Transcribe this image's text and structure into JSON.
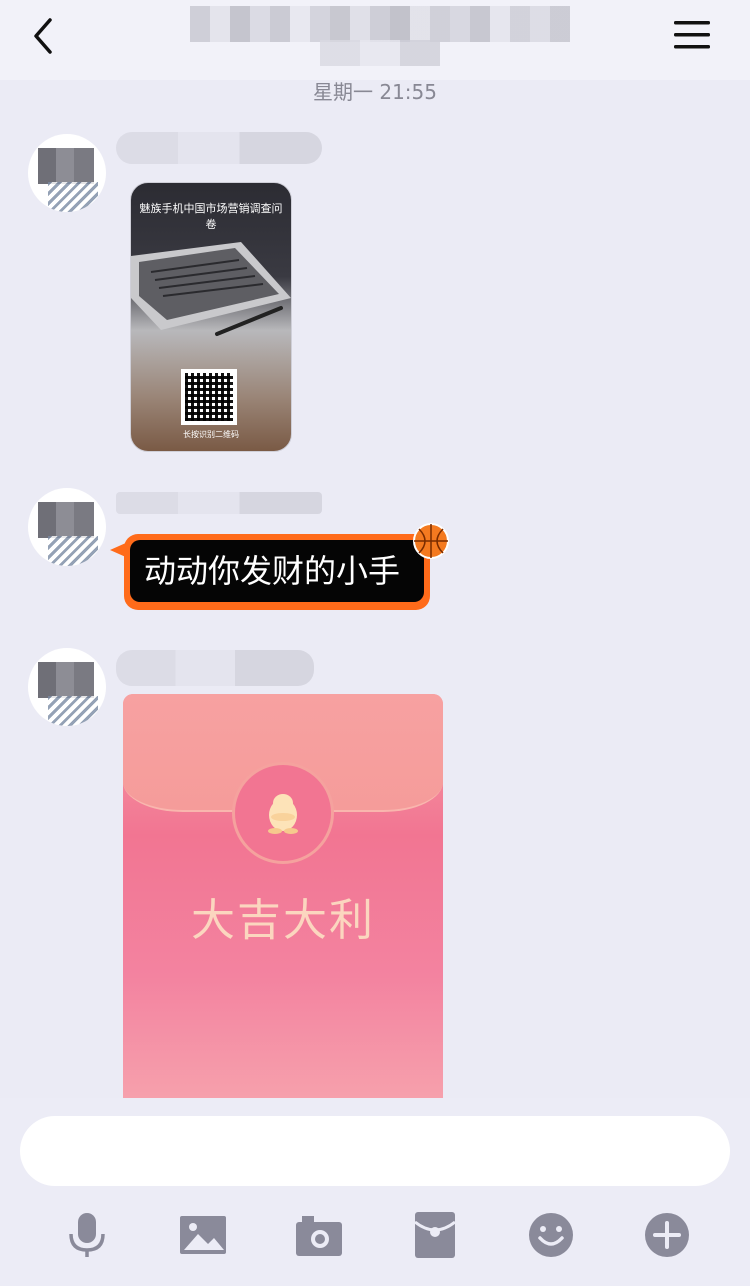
{
  "header": {
    "back_icon": "chevron-left-icon",
    "menu_icon": "hamburger-menu-icon"
  },
  "timestamp": "星期一 21:55",
  "messages": [
    {
      "type": "image-card",
      "card_title": "魅族手机中国市场营销调查问卷",
      "card_footer": "长按识别二维码"
    },
    {
      "type": "text",
      "text": "动动你发财的小手",
      "bubble_color": "#ff6b1a",
      "decoration_icon": "basketball-icon"
    },
    {
      "type": "red-envelope",
      "greeting": "大吉大利",
      "icon": "penguin-icon"
    }
  ],
  "colors": {
    "background": "#ebebf5",
    "bubble_border": "#ff6b1a",
    "envelope": "#f27592",
    "icon": "#8a8a9a"
  },
  "input": {
    "value": "",
    "placeholder": ""
  },
  "toolbar": [
    {
      "icon": "microphone-icon"
    },
    {
      "icon": "image-icon"
    },
    {
      "icon": "camera-icon"
    },
    {
      "icon": "red-envelope-icon"
    },
    {
      "icon": "emoji-icon"
    },
    {
      "icon": "plus-icon"
    }
  ]
}
